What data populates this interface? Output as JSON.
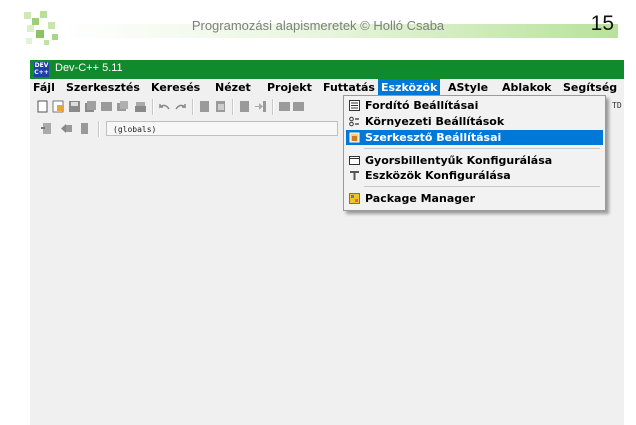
{
  "slide": {
    "title": "Programozási alapismeretek © Holló Csaba",
    "page_number": "15"
  },
  "window": {
    "title": "Dev-C++ 5.11",
    "icon_label": "DEV C++"
  },
  "menubar": {
    "items": [
      {
        "label": "Fájl"
      },
      {
        "label": "Szerkesztés"
      },
      {
        "label": "Keresés"
      },
      {
        "label": "Nézet"
      },
      {
        "label": "Projekt"
      },
      {
        "label": "Futtatás"
      },
      {
        "label": "Eszközök",
        "active": true
      },
      {
        "label": "AStyle"
      },
      {
        "label": "Ablakok"
      },
      {
        "label": "Segítség"
      }
    ]
  },
  "toolbar": {
    "scope_value": "(globals)",
    "clipped_text": "TD"
  },
  "dropdown": {
    "items": [
      {
        "label": "Fordító Beállításai",
        "icon": "compiler-options-icon"
      },
      {
        "label": "Környezeti Beállítások",
        "icon": "environment-options-icon"
      },
      {
        "label": "Szerkesztő Beállításai",
        "icon": "editor-options-icon",
        "highlighted": true
      },
      {
        "label": "Gyorsbillentyűk Konfigurálása",
        "icon": "shortcuts-icon"
      },
      {
        "label": "Eszközök Konfigurálása",
        "icon": "tools-icon"
      },
      {
        "label": "Package Manager",
        "icon": "package-manager-icon"
      }
    ]
  },
  "colors": {
    "titlebar": "#0f8a2c",
    "menu_highlight": "#0078d7"
  }
}
